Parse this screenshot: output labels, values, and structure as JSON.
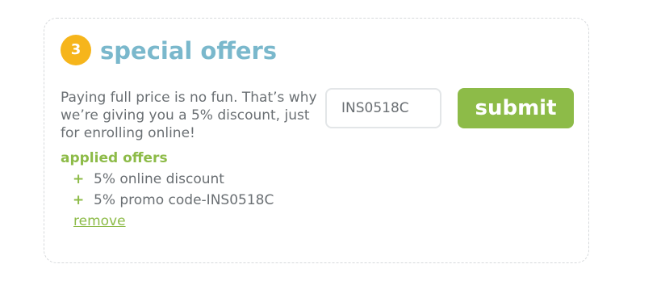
{
  "section": {
    "step_number": "3",
    "title": "special offers",
    "description": "Paying full price is no fun. That’s why we’re giving you a 5% discount, just for enrolling online!"
  },
  "promo": {
    "code_value": "INS0518C",
    "submit_label": "submit"
  },
  "applied_offers": {
    "heading": "applied offers",
    "items": [
      {
        "icon": "+",
        "label": "5% online discount"
      },
      {
        "icon": "+",
        "label": "5% promo code-INS0518C"
      }
    ],
    "remove_label": "remove"
  },
  "colors": {
    "badge": "#f6b51b",
    "title": "#7ab8cc",
    "accent_green": "#8dbb48",
    "body_text": "#6a6f73"
  }
}
